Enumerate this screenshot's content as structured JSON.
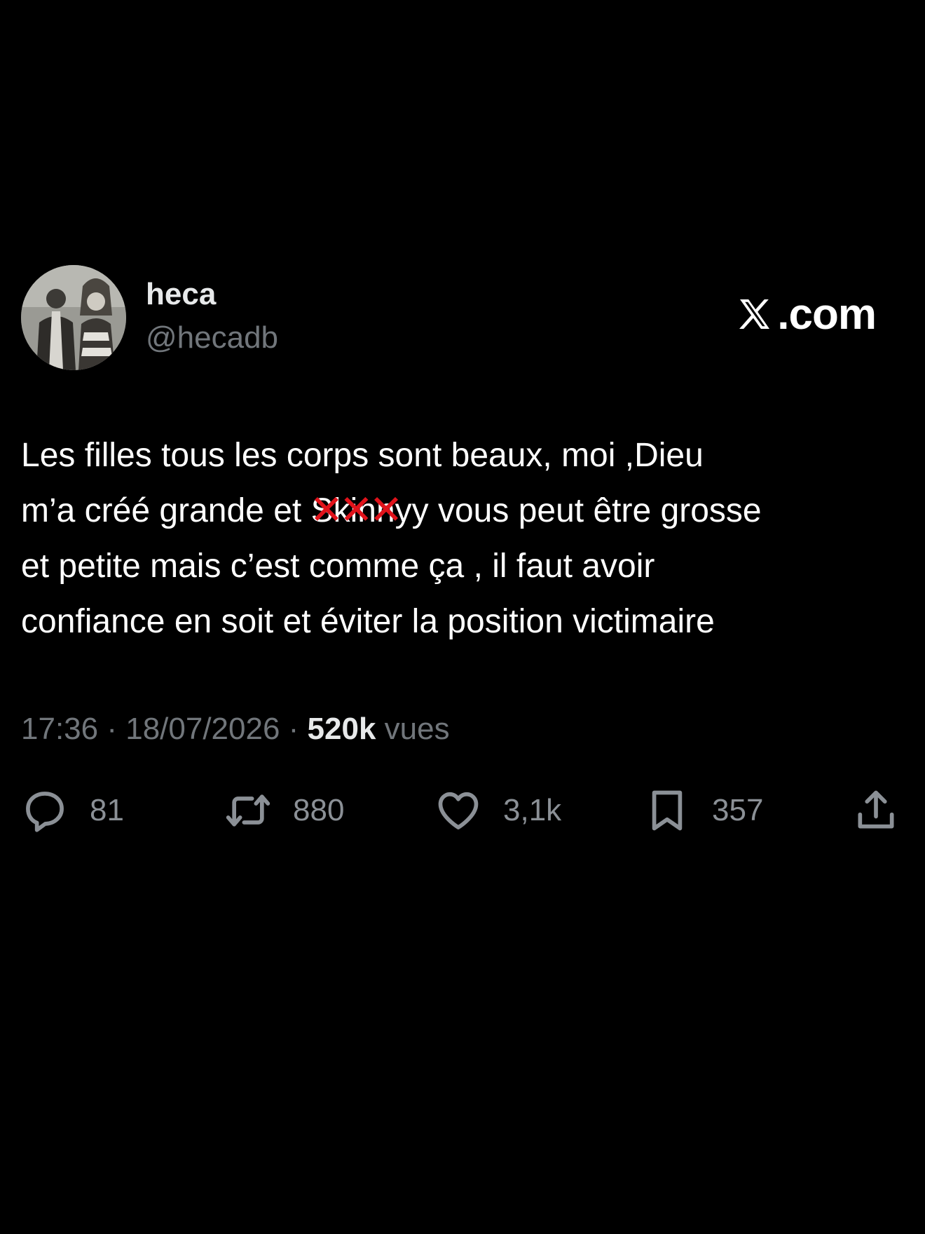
{
  "author": {
    "display_name": "heca",
    "handle": "@hecadb"
  },
  "brand": {
    "label": ".com",
    "icon": "x-logo-icon"
  },
  "tweet": {
    "line1": "Les filles tous les corps sont beaux, moi ,Dieu",
    "line2_before": "m’a créé grande et ",
    "line2_censored": "Skinny",
    "line2_after": "y vous peut être grosse",
    "line3": "et petite mais c’est comme ça , il faut avoir",
    "line4": "confiance en soit et éviter la position victimaire",
    "censor_mark": "✕✕✕"
  },
  "meta": {
    "time": "17:36",
    "separator": " · ",
    "date": "18/07/2026",
    "views_count": "520k",
    "views_label": " vues"
  },
  "actions": {
    "replies": "81",
    "reposts": "880",
    "likes": "3,1k",
    "bookmarks": "357"
  },
  "colors": {
    "background": "#000000",
    "text": "#ffffff",
    "secondary": "#71767b",
    "censor": "#e0131b"
  }
}
